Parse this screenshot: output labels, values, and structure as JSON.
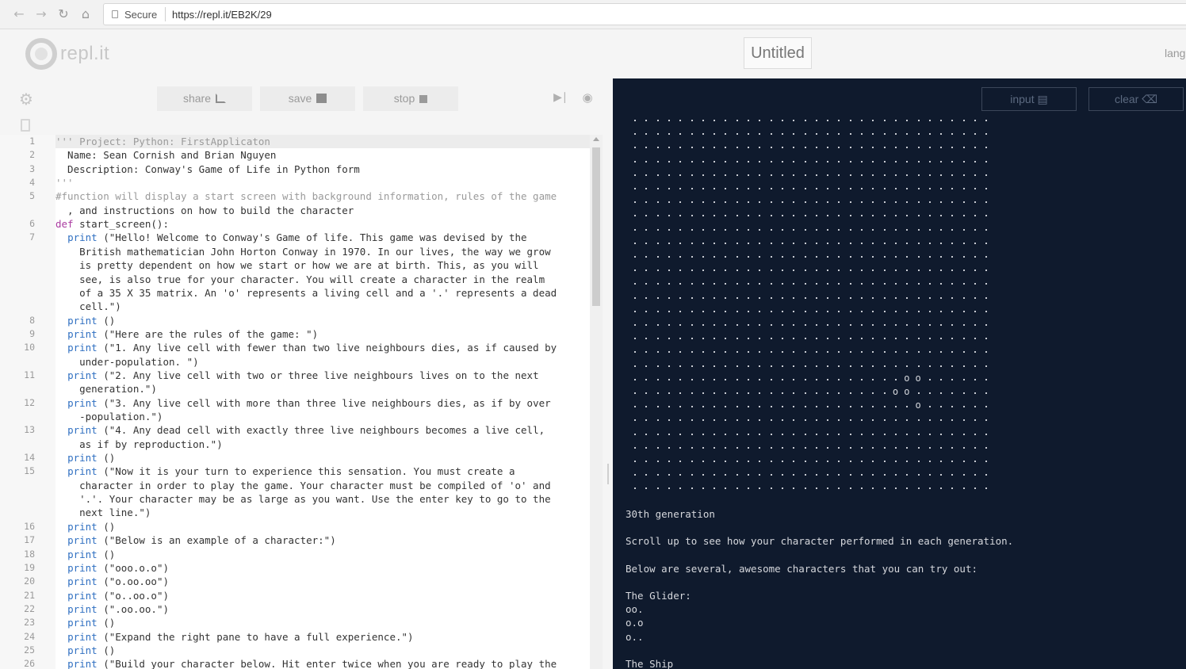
{
  "browser": {
    "secure_label": "Secure",
    "url": "https://repl.it/EB2K/29"
  },
  "header": {
    "logo_text": "repl.it",
    "title": "Untitled",
    "lang": "lang"
  },
  "toolbar": {
    "share_label": "share",
    "save_label": "save",
    "stop_label": "stop"
  },
  "code": {
    "lines": [
      {
        "num": "1",
        "text": "''' Project: Python: FirstApplicaton"
      },
      {
        "num": "2",
        "text": "  Name: Sean Cornish and Brian Nguyen"
      },
      {
        "num": "3",
        "text": "  Description: Conway's Game of Life in Python form"
      },
      {
        "num": "4",
        "text": "'''"
      },
      {
        "num": "5",
        "text": "#function will display a start screen with background information, rules of the game"
      },
      {
        "num": "",
        "text": "  , and instructions on how to build the character"
      },
      {
        "num": "6",
        "text": "def start_screen():"
      },
      {
        "num": "7",
        "text": "  print (\"Hello! Welcome to Conway's Game of life. This game was devised by the"
      },
      {
        "num": "",
        "text": "    British mathematician John Horton Conway in 1970. In our lives, the way we grow"
      },
      {
        "num": "",
        "text": "    is pretty dependent on how we start or how we are at birth. This, as you will"
      },
      {
        "num": "",
        "text": "    see, is also true for your character. You will create a character in the realm"
      },
      {
        "num": "",
        "text": "    of a 35 X 35 matrix. An 'o' represents a living cell and a '.' represents a dead"
      },
      {
        "num": "",
        "text": "    cell.\")"
      },
      {
        "num": "8",
        "text": "  print ()"
      },
      {
        "num": "9",
        "text": "  print (\"Here are the rules of the game: \")"
      },
      {
        "num": "10",
        "text": "  print (\"1. Any live cell with fewer than two live neighbours dies, as if caused by"
      },
      {
        "num": "",
        "text": "    under-population. \")"
      },
      {
        "num": "11",
        "text": "  print (\"2. Any live cell with two or three live neighbours lives on to the next"
      },
      {
        "num": "",
        "text": "    generation.\")"
      },
      {
        "num": "12",
        "text": "  print (\"3. Any live cell with more than three live neighbours dies, as if by over"
      },
      {
        "num": "",
        "text": "    -population.\")"
      },
      {
        "num": "13",
        "text": "  print (\"4. Any dead cell with exactly three live neighbours becomes a live cell,"
      },
      {
        "num": "",
        "text": "    as if by reproduction.\")"
      },
      {
        "num": "14",
        "text": "  print ()"
      },
      {
        "num": "15",
        "text": "  print (\"Now it is your turn to experience this sensation. You must create a"
      },
      {
        "num": "",
        "text": "    character in order to play the game. Your character must be compiled of 'o' and"
      },
      {
        "num": "",
        "text": "    '.'. Your character may be as large as you want. Use the enter key to go to the"
      },
      {
        "num": "",
        "text": "    next line.\")"
      },
      {
        "num": "16",
        "text": "  print ()"
      },
      {
        "num": "17",
        "text": "  print (\"Below is an example of a character:\")"
      },
      {
        "num": "18",
        "text": "  print ()"
      },
      {
        "num": "19",
        "text": "  print (\"ooo.o.o\")"
      },
      {
        "num": "20",
        "text": "  print (\"o.oo.oo\")"
      },
      {
        "num": "21",
        "text": "  print (\"o..oo.o\")"
      },
      {
        "num": "22",
        "text": "  print (\".oo.oo.\")"
      },
      {
        "num": "23",
        "text": "  print ()"
      },
      {
        "num": "24",
        "text": "  print (\"Expand the right pane to have a full experience.\")"
      },
      {
        "num": "25",
        "text": "  print ()"
      },
      {
        "num": "26",
        "text": "  print (\"Build your character below. Hit enter twice when you are ready to play the"
      }
    ]
  },
  "console": {
    "input_label": "input",
    "clear_label": "clear",
    "grid": {
      "rows": 28,
      "cols": 32
    },
    "live_cells": [
      {
        "row": 19,
        "col": 24
      },
      {
        "row": 19,
        "col": 25
      },
      {
        "row": 20,
        "col": 23
      },
      {
        "row": 20,
        "col": 24
      },
      {
        "row": 21,
        "col": 25
      }
    ],
    "lines": [
      {
        "text": "30th generation"
      },
      {
        "text": "Scroll up to see how your character performed in each generation."
      },
      {
        "text": "Below are several, awesome characters that you can try out:"
      },
      {
        "text": "The Glider:"
      },
      {
        "text": "oo."
      },
      {
        "text": "o.o"
      },
      {
        "text": "o.."
      },
      {
        "text": "The Ship"
      }
    ]
  },
  "colors": {
    "console_bg": "#0f1a2d",
    "console_text": "#d6d8dd",
    "keyword": "#aa3ba0",
    "string": "#2b2b2b",
    "comment": "#9a9a9a",
    "function": "#2f6fc1"
  }
}
